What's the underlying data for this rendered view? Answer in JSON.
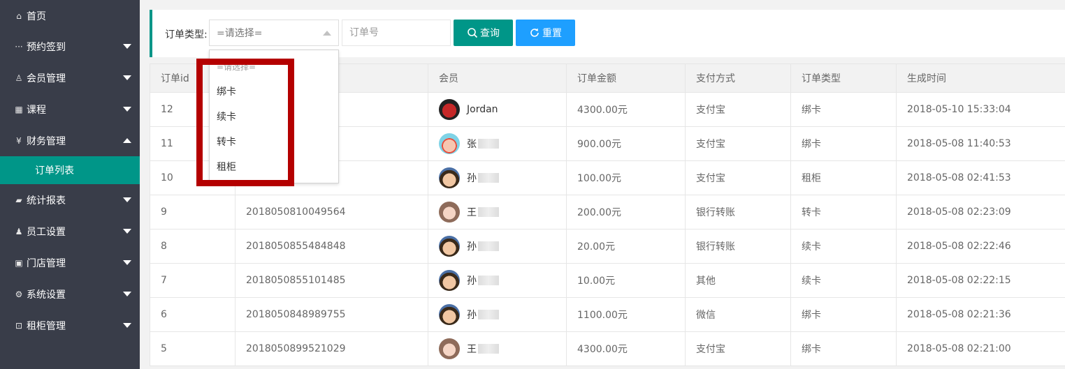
{
  "sidebar": {
    "items": [
      {
        "label": "首页",
        "icon": "home-icon",
        "glyph": "⌂",
        "arrow": "none"
      },
      {
        "label": "预约签到",
        "icon": "more-icon",
        "glyph": "···",
        "arrow": "down"
      },
      {
        "label": "会员管理",
        "icon": "user-icon",
        "glyph": "♙",
        "arrow": "down"
      },
      {
        "label": "课程",
        "icon": "grid-icon",
        "glyph": "▦",
        "arrow": "down"
      },
      {
        "label": "财务管理",
        "icon": "yen-icon",
        "glyph": "¥",
        "arrow": "up"
      },
      {
        "label": "统计报表",
        "icon": "chat-icon",
        "glyph": "▰",
        "arrow": "down"
      },
      {
        "label": "员工设置",
        "icon": "users-icon",
        "glyph": "♟",
        "arrow": "down"
      },
      {
        "label": "门店管理",
        "icon": "apps-icon",
        "glyph": "▣",
        "arrow": "down"
      },
      {
        "label": "系统设置",
        "icon": "gear-icon",
        "glyph": "⚙",
        "arrow": "down"
      },
      {
        "label": "租柜管理",
        "icon": "lock-icon",
        "glyph": "⊡",
        "arrow": "down"
      }
    ],
    "active_sub": "订单列表"
  },
  "filter": {
    "label": "订单类型:",
    "select_value": "=请选择=",
    "order_no_placeholder": "订单号",
    "search_label": "查询",
    "reset_label": "重置"
  },
  "dropdown": {
    "placeholder": "=请选择=",
    "options": [
      "绑卡",
      "续卡",
      "转卡",
      "租柜"
    ]
  },
  "table": {
    "columns": [
      "订单id",
      "",
      "会员",
      "订单金额",
      "支付方式",
      "订单类型",
      "生成时间"
    ],
    "rows": [
      {
        "id": "12",
        "order_no": "",
        "member": "Jordan",
        "avatar": "jordan",
        "amount": "4300.00元",
        "pay": "支付宝",
        "type": "绑卡",
        "time": "2018-05-10 15:33:04"
      },
      {
        "id": "11",
        "order_no": "",
        "member": "张",
        "avatar": "girl",
        "amount": "900.00元",
        "pay": "支付宝",
        "type": "绑卡",
        "time": "2018-05-08 11:40:53"
      },
      {
        "id": "10",
        "order_no": "",
        "member": "孙",
        "avatar": "boy",
        "amount": "100.00元",
        "pay": "支付宝",
        "type": "租柜",
        "time": "2018-05-08 02:41:53"
      },
      {
        "id": "9",
        "order_no": "2018050810049564",
        "member": "王",
        "avatar": "baby",
        "amount": "200.00元",
        "pay": "银行转账",
        "type": "转卡",
        "time": "2018-05-08 02:23:09"
      },
      {
        "id": "8",
        "order_no": "2018050855484848",
        "member": "孙",
        "avatar": "boy",
        "amount": "20.00元",
        "pay": "银行转账",
        "type": "续卡",
        "time": "2018-05-08 02:22:46"
      },
      {
        "id": "7",
        "order_no": "2018050855101485",
        "member": "孙",
        "avatar": "boy",
        "amount": "10.00元",
        "pay": "其他",
        "type": "续卡",
        "time": "2018-05-08 02:22:15"
      },
      {
        "id": "6",
        "order_no": "2018050848989755",
        "member": "孙",
        "avatar": "boy",
        "amount": "1100.00元",
        "pay": "微信",
        "type": "绑卡",
        "time": "2018-05-08 02:21:36"
      },
      {
        "id": "5",
        "order_no": "2018050899521029",
        "member": "王",
        "avatar": "baby",
        "amount": "4300.00元",
        "pay": "支付宝",
        "type": "绑卡",
        "time": "2018-05-08 02:21:00"
      }
    ]
  },
  "colors": {
    "sidebar": "#393d49",
    "accent": "#009688",
    "blue": "#1e9fff",
    "highlight": "#b40000"
  }
}
